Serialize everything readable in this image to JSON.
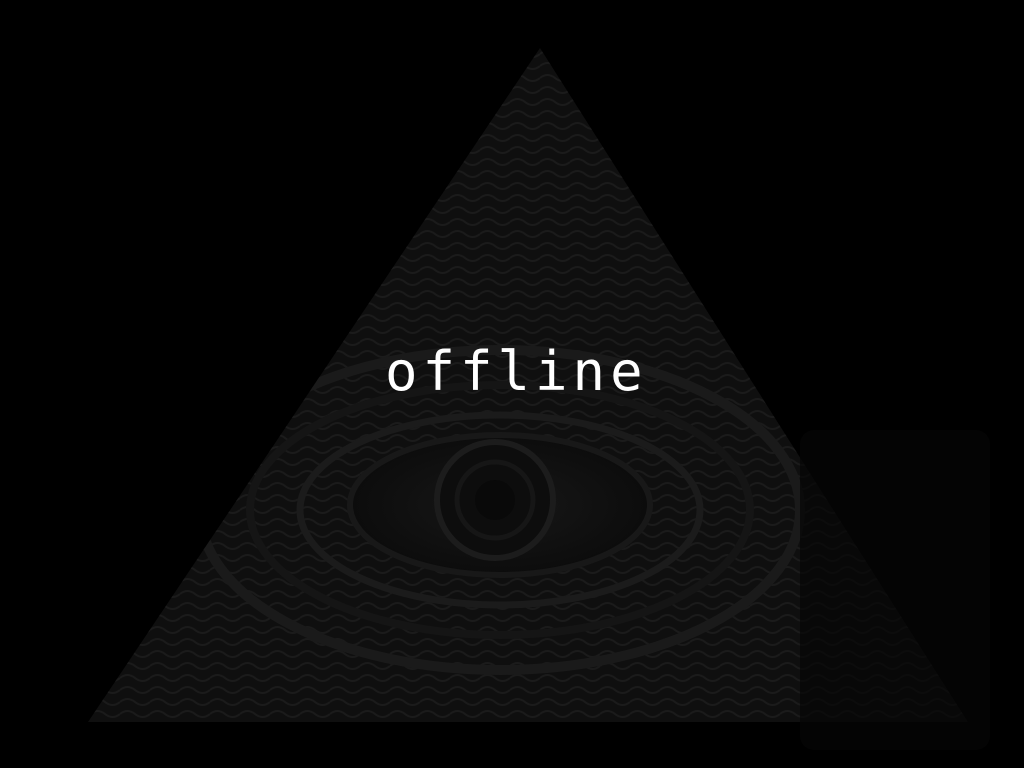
{
  "screen": {
    "status_text": "offline",
    "background_color": "#000000",
    "text_color": "#ffffff",
    "art_color": "#121212"
  },
  "background_art": {
    "icon": "all-seeing-eye-pyramid-icon"
  }
}
